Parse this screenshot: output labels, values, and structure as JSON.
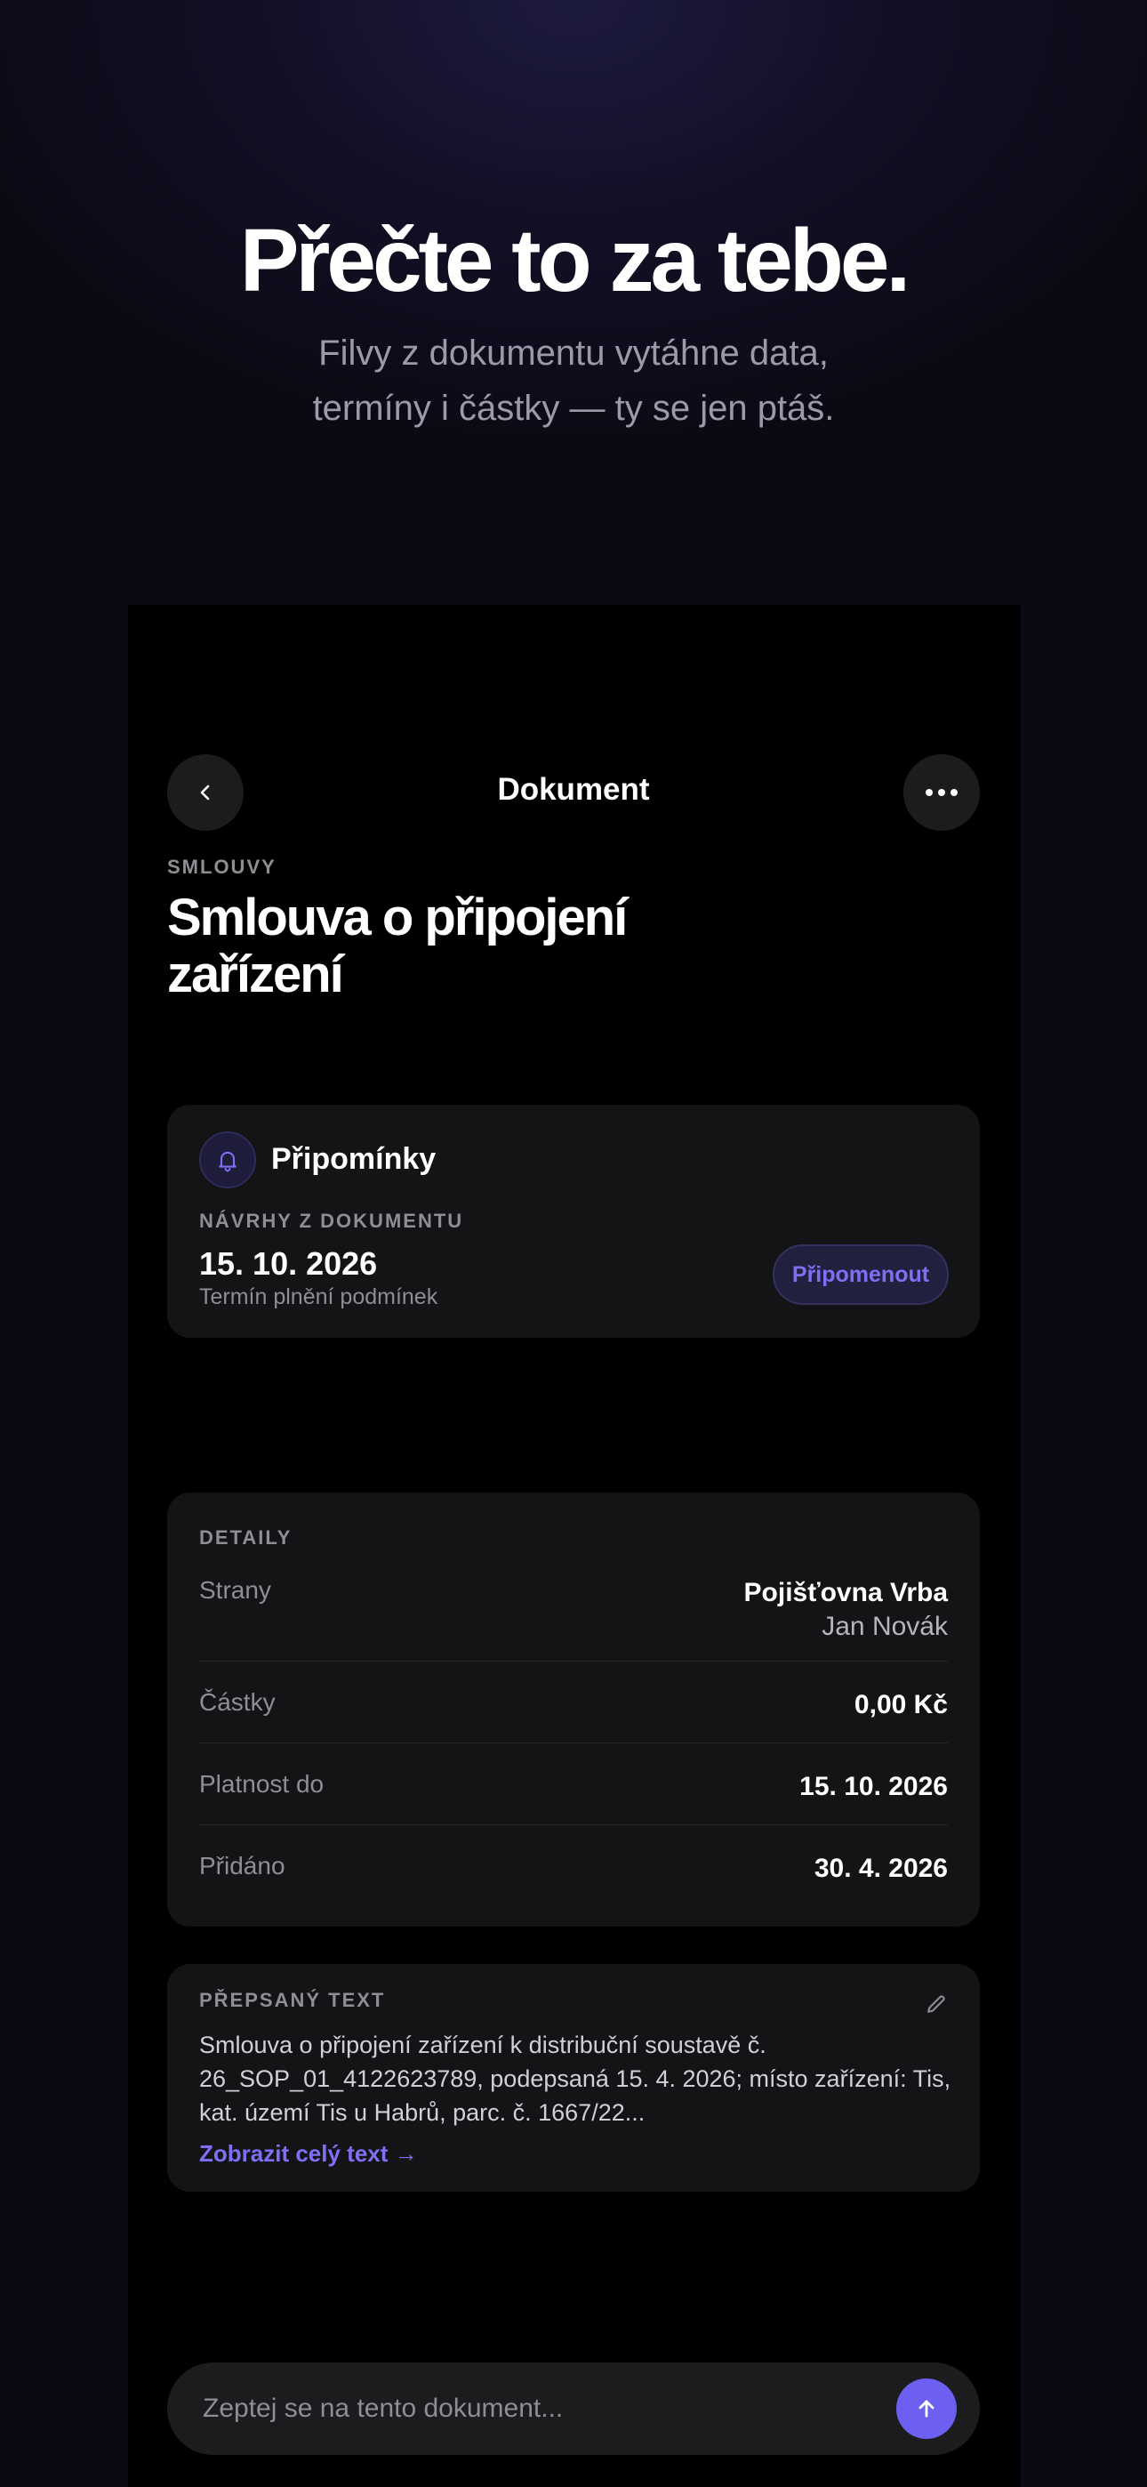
{
  "hero": {
    "title": "Přečte to za tebe.",
    "subtitle_line1": "Filvy z dokumentu vytáhne data,",
    "subtitle_line2": "termíny i částky — ty se jen ptáš."
  },
  "nav": {
    "title": "Dokument",
    "back_icon": "chevron-left-icon",
    "more_icon": "more-horizontal-icon"
  },
  "document": {
    "category": "SMLOUVY",
    "title": "Smlouva o připojení zařízení"
  },
  "reminders": {
    "icon": "bell-icon",
    "title": "Připomínky",
    "section_label": "NÁVRHY Z DOKUMENTU",
    "date": "15. 10. 2026",
    "description": "Termín plnění podmínek",
    "button_label": "Připomenout"
  },
  "details": {
    "section_label": "DETAILY",
    "rows": [
      {
        "label": "Strany",
        "value": "Pojišťovna Vrba",
        "value2": "Jan Novák"
      },
      {
        "label": "Částky",
        "value": "0,00 Kč"
      },
      {
        "label": "Platnost do",
        "value": "15. 10. 2026"
      },
      {
        "label": "Přidáno",
        "value": "30. 4. 2026"
      }
    ]
  },
  "transcript": {
    "section_label": "PŘEPSANÝ TEXT",
    "edit_icon": "pencil-icon",
    "text": "Smlouva o připojení zařízení k distribuční soustavě č. 26_SOP_01_4122623789, podepsaná 15. 4. 2026; místo zařízení: Tis, kat. území Tis u Habrů, parc. č. 1667/22...",
    "link_label": "Zobrazit celý text →"
  },
  "ask": {
    "placeholder": "Zeptej se na tento dokument...",
    "send_icon": "arrow-up-icon"
  },
  "colors": {
    "accent": "#6d5ff0",
    "accent_text": "#7f6ff5",
    "background": "#000000",
    "card": "#141416"
  }
}
